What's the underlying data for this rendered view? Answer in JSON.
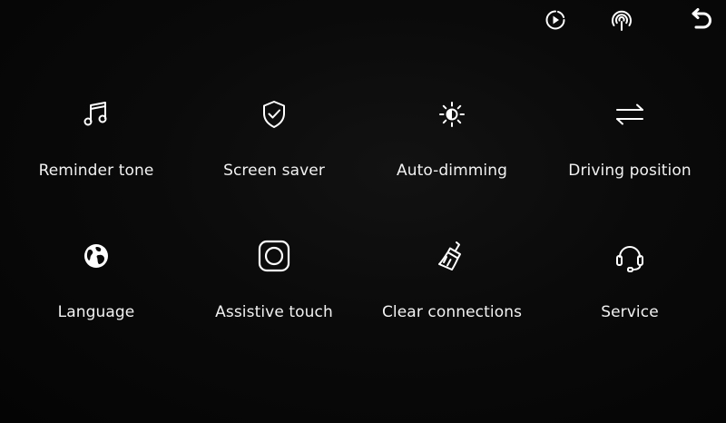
{
  "topbar": {
    "play_icon": "play-circle-icon",
    "cast_icon": "wireless-broadcast-icon",
    "back_icon": "back-arrow-icon"
  },
  "menu": {
    "items": [
      {
        "label": "Reminder tone",
        "icon": "music-note-icon"
      },
      {
        "label": "Screen saver",
        "icon": "shield-check-icon"
      },
      {
        "label": "Auto-dimming",
        "icon": "brightness-sun-icon"
      },
      {
        "label": "Driving position",
        "icon": "swap-arrows-icon"
      },
      {
        "label": "Language",
        "icon": "globe-icon"
      },
      {
        "label": "Assistive touch",
        "icon": "assistive-touch-icon"
      },
      {
        "label": "Clear connections",
        "icon": "broom-icon"
      },
      {
        "label": "Service",
        "icon": "headset-icon"
      }
    ]
  },
  "colors": {
    "background": "#050505",
    "foreground": "#ffffff"
  }
}
